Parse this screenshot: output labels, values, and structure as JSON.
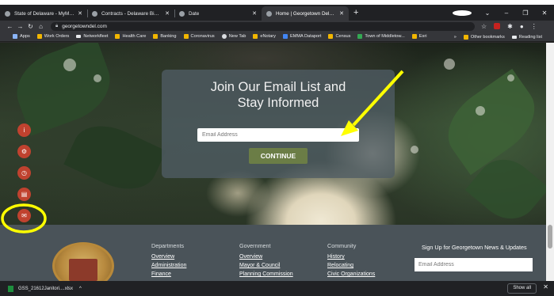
{
  "browser": {
    "tabs": [
      {
        "title": "State of Delaware - MyMarketpl",
        "active": false
      },
      {
        "title": "Contracts - Delaware Bids and C",
        "active": false
      },
      {
        "title": "Date",
        "active": false
      },
      {
        "title": "Home | Georgetown Delaware",
        "active": true
      }
    ],
    "new_tab_label": "+",
    "url": "georgetowndel.com",
    "bookmarks": [
      "Apps",
      "Work Orders",
      "Networkfleet",
      "Health Care",
      "Banking",
      "Coronavirus",
      "New Tab",
      "eNotary",
      "EMMA Dataport",
      "Census",
      "Town of Middletow...",
      "Esri"
    ],
    "bookmarks_more": "»",
    "other_bookmarks": "Other bookmarks",
    "reading_list": "Reading list"
  },
  "hero": {
    "title": "Join Our Email List and Stay Informed",
    "email_placeholder": "Email Address",
    "continue_label": "CONTINUE"
  },
  "quick_buttons": [
    {
      "icon": "info-icon",
      "glyph": "i"
    },
    {
      "icon": "gear-icon",
      "glyph": "⚙"
    },
    {
      "icon": "clock-icon",
      "glyph": "◷"
    },
    {
      "icon": "newspaper-icon",
      "glyph": "▤"
    },
    {
      "icon": "envelope-icon",
      "glyph": "✉"
    }
  ],
  "footer": {
    "columns": [
      {
        "heading": "Departments",
        "links": [
          "Overview",
          "Administration",
          "Finance"
        ]
      },
      {
        "heading": "Government",
        "links": [
          "Overview",
          "Mayor & Council",
          "Planning Commission"
        ]
      },
      {
        "heading": "Community",
        "links": [
          "History",
          "Relocating",
          "Civic Organizations"
        ]
      }
    ],
    "signup_heading": "Sign Up for Georgetown News & Updates",
    "signup_placeholder": "Email Address"
  },
  "downloads": {
    "file_name": "GSS_21612Janitori....xlsx",
    "show_all": "Show all"
  },
  "colors": {
    "accent_red": "#c0422f",
    "continue_green": "#6b7d46",
    "annotation_yellow": "#ffff00",
    "footer_bg": "#4a5359"
  }
}
